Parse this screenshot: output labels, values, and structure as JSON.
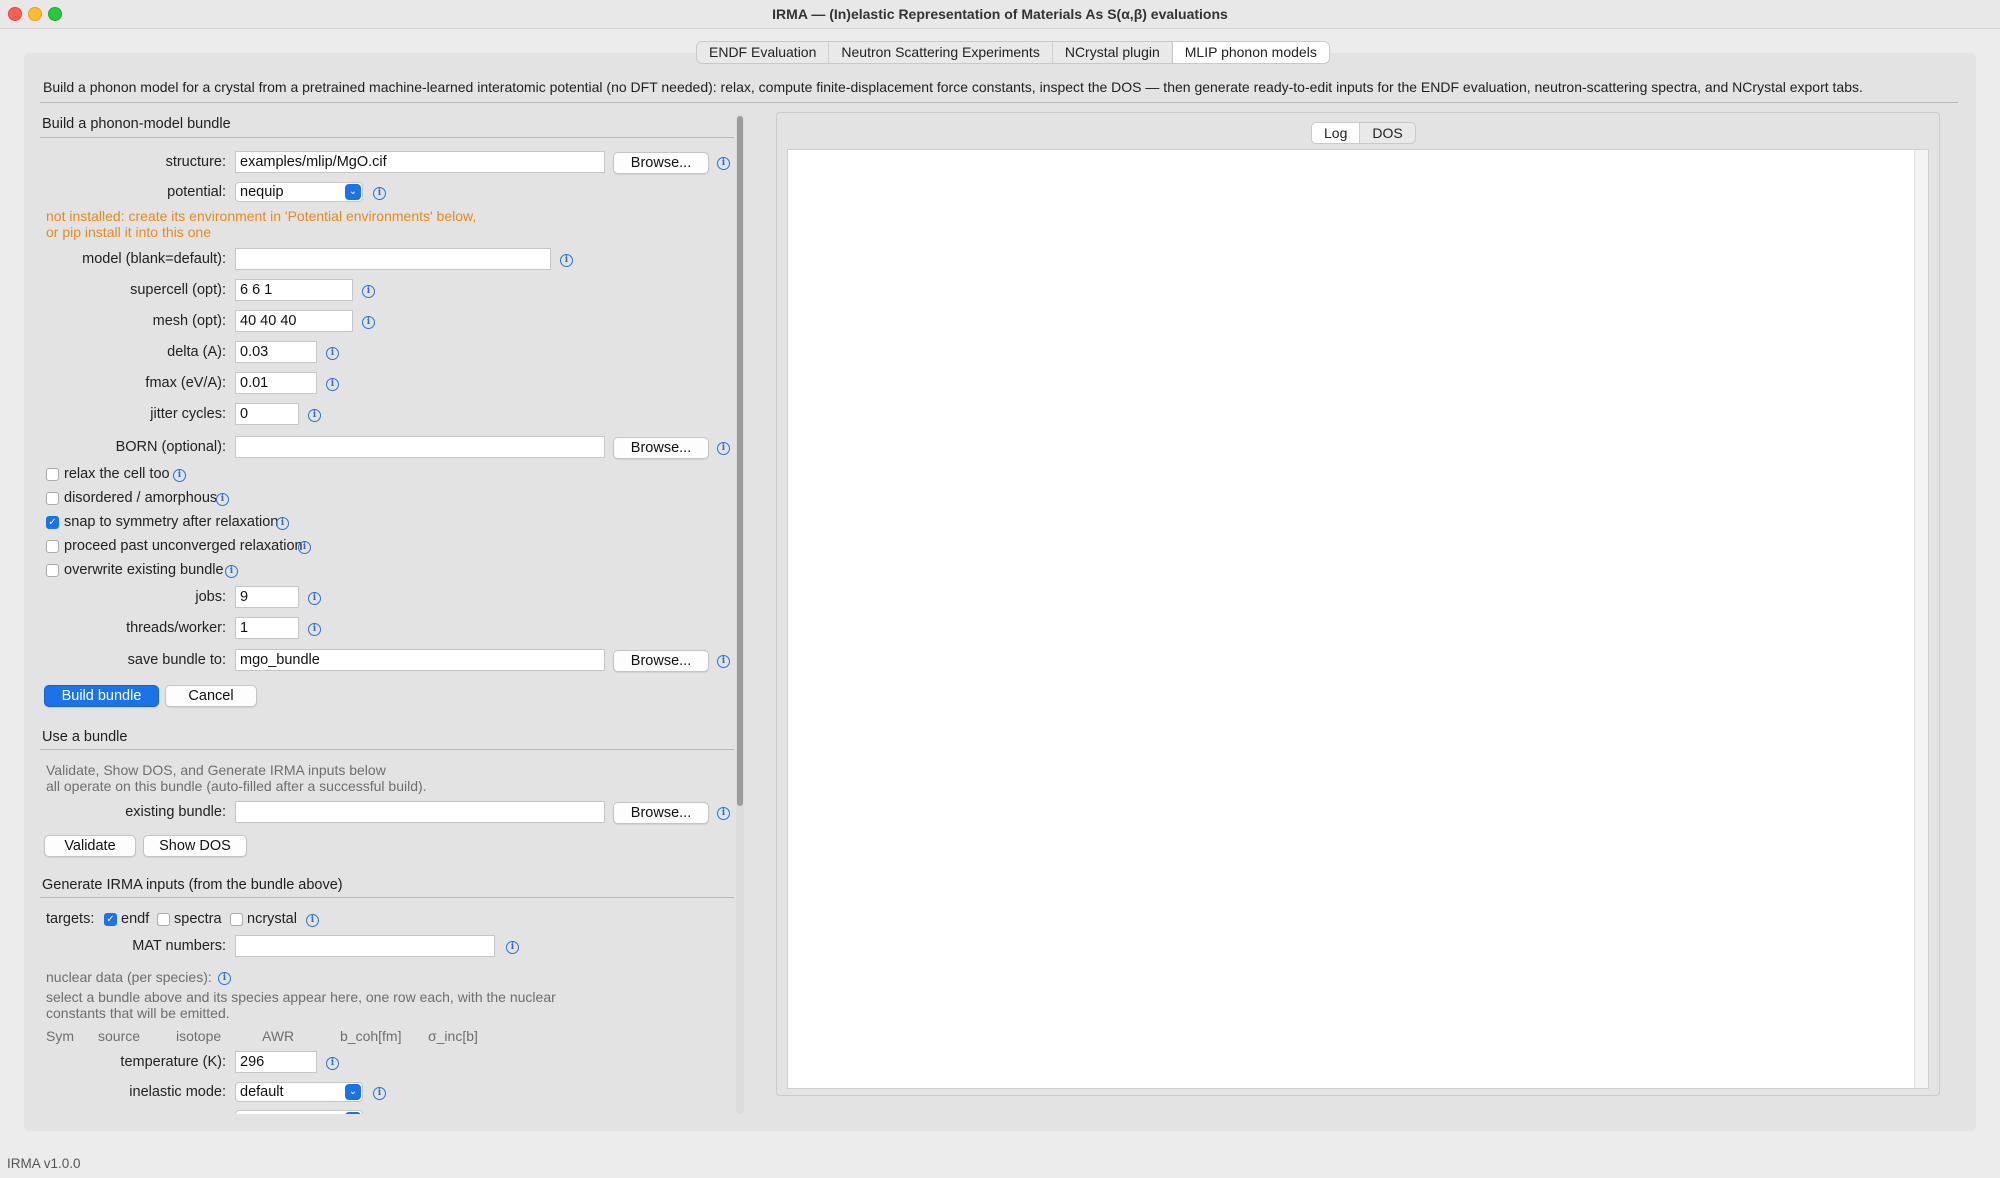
{
  "window": {
    "title": "IRMA — (In)elastic Representation of Materials As S(α,β) evaluations"
  },
  "tabs": [
    {
      "label": "ENDF Evaluation"
    },
    {
      "label": "Neutron Scattering Experiments"
    },
    {
      "label": "NCrystal plugin"
    },
    {
      "label": "MLIP phonon models"
    }
  ],
  "description": "Build a phonon model for a crystal from a pretrained machine-learned interatomic potential (no DFT needed): relax, compute finite-displacement force constants, inspect the DOS — then generate ready-to-edit inputs for the ENDF evaluation, neutron-scattering spectra, and NCrystal export tabs.",
  "build": {
    "heading": "Build a phonon-model bundle",
    "structure_label": "structure:",
    "structure_value": "examples/mlip/MgO.cif",
    "potential_label": "potential:",
    "potential_value": "nequip",
    "warning_line1": "not installed: create its environment in 'Potential environments' below,",
    "warning_line2": "or pip install it into this one",
    "model_label": "model (blank=default):",
    "model_value": "",
    "supercell_label": "supercell (opt):",
    "supercell_value": "6 6 1",
    "mesh_label": "mesh (opt):",
    "mesh_value": "40 40 40",
    "delta_label": "delta (A):",
    "delta_value": "0.03",
    "fmax_label": "fmax (eV/A):",
    "fmax_value": "0.01",
    "jitter_label": "jitter cycles:",
    "jitter_value": "0",
    "born_label": "BORN (optional):",
    "born_value": "",
    "relax_cell_label": "relax the cell too",
    "relax_cell_checked": false,
    "disordered_label": "disordered / amorphous",
    "disordered_checked": false,
    "snap_label": "snap to symmetry after relaxation",
    "snap_checked": true,
    "proceed_label": "proceed past unconverged relaxation",
    "proceed_checked": false,
    "overwrite_label": "overwrite existing bundle",
    "overwrite_checked": false,
    "jobs_label": "jobs:",
    "jobs_value": "9",
    "threads_label": "threads/worker:",
    "threads_value": "1",
    "save_label": "save bundle to:",
    "save_value": "mgo_bundle",
    "browse_label": "Browse...",
    "build_button": "Build bundle",
    "cancel_button": "Cancel"
  },
  "use": {
    "heading": "Use a bundle",
    "note_line1": "Validate, Show DOS, and Generate IRMA inputs below",
    "note_line2": "all operate on this bundle (auto-filled after a successful build).",
    "existing_label": "existing bundle:",
    "existing_value": "",
    "validate_button": "Validate",
    "show_dos_button": "Show DOS"
  },
  "generate": {
    "heading": "Generate IRMA inputs (from the bundle above)",
    "targets_label": "targets:",
    "target_endf": "endf",
    "target_endf_checked": true,
    "target_spectra": "spectra",
    "target_spectra_checked": false,
    "target_ncrystal": "ncrystal",
    "target_ncrystal_checked": false,
    "mat_label": "MAT numbers:",
    "mat_value": "",
    "nuclear_label": "nuclear data (per species):",
    "nuclear_note1": "select a bundle above and its species appear here, one row each, with the nuclear",
    "nuclear_note2": "constants that will be emitted.",
    "columns": [
      "Sym",
      "source",
      "isotope",
      "AWR",
      "b_coh[fm]",
      "σ_inc[b]"
    ],
    "temperature_label": "temperature (K):",
    "temperature_value": "296",
    "inelastic_label": "inelastic mode:",
    "inelastic_value": "default"
  },
  "output": {
    "tabs": [
      {
        "label": "Log"
      },
      {
        "label": "DOS"
      }
    ]
  },
  "status": "IRMA v1.0.0",
  "colors": {
    "accent": "#1a73e8",
    "warning": "#e8891c"
  }
}
